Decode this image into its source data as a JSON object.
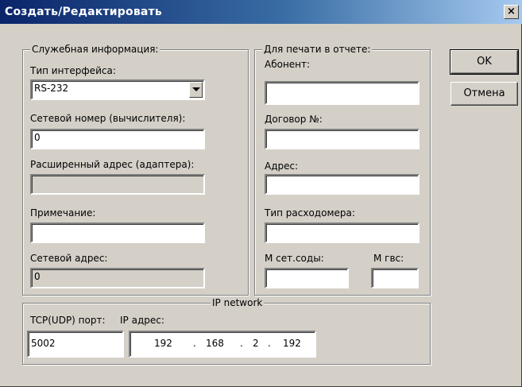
{
  "window": {
    "title": "Создать/Редактировать",
    "close_glyph": "×"
  },
  "service_info": {
    "legend": "Служебная информация:",
    "interface_type_label": "Тип интерфейса:",
    "interface_type_value": "RS-232",
    "network_number_label": "Сетевой номер (вычислителя):",
    "network_number_value": "0",
    "extended_address_label": "Расширенный адрес (адаптера):",
    "extended_address_value": "",
    "note_label": "Примечание:",
    "note_value": "",
    "network_address_label": "Сетевой адрес:",
    "network_address_value": "0"
  },
  "print_info": {
    "legend": "Для печати в отчете:",
    "subscriber_label": "Абонент:",
    "subscriber_value": "",
    "contract_label": "Договор №:",
    "contract_value": "",
    "address_label": "Адрес:",
    "address_value": "",
    "flowmeter_type_label": "Тип расходомера:",
    "flowmeter_type_value": "",
    "m_network_water_label": "М сет.соды:",
    "m_network_water_value": "",
    "m_hot_water_label": "М гвс:",
    "m_hot_water_value": ""
  },
  "ip_network": {
    "legend": "IP network",
    "port_label": "TCP(UDP) порт:",
    "ip_label": "IP адрес:",
    "port_value": "5002",
    "ip_octets": [
      "192",
      "168",
      "2",
      "192"
    ],
    "ip_separator": "."
  },
  "buttons": {
    "ok": "OK",
    "cancel": "Отмена"
  }
}
